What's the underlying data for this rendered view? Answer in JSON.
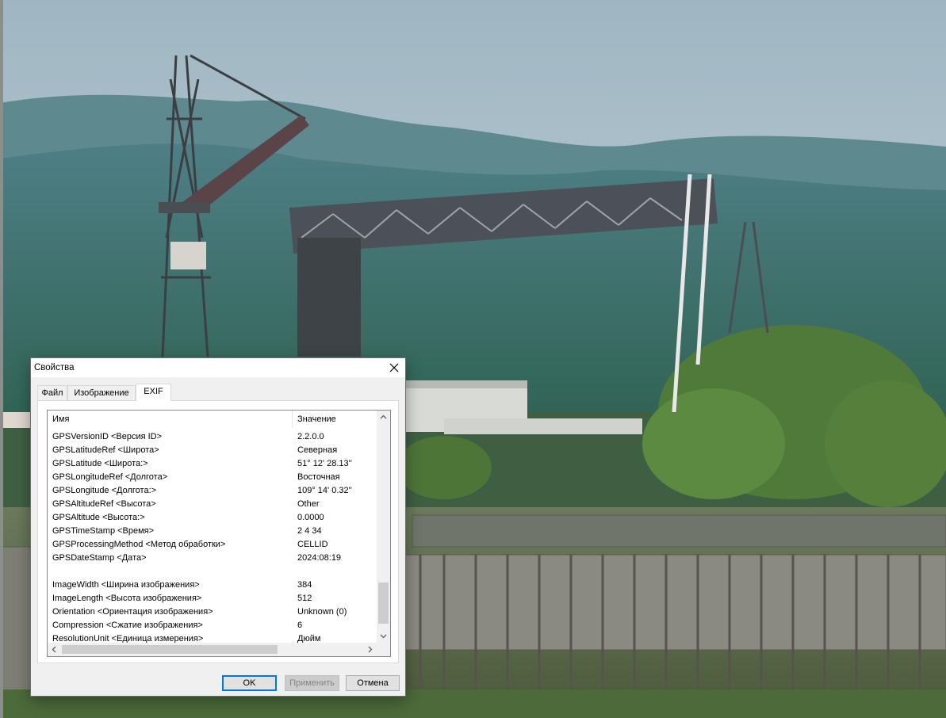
{
  "dialog": {
    "title": "Свойства",
    "close_icon": "close-icon",
    "tabs": [
      {
        "label": "Файл",
        "active": false
      },
      {
        "label": "Изображение",
        "active": false
      },
      {
        "label": "EXIF",
        "active": true
      }
    ],
    "list": {
      "columns": [
        "Имя",
        "Значение"
      ],
      "rows": [
        {
          "name": "GPSVersionID <Версия ID>",
          "value": "2.2.0.0"
        },
        {
          "name": "GPSLatitudeRef <Широта>",
          "value": "Северная"
        },
        {
          "name": "GPSLatitude <Широта:>",
          "value": "51° 12' 28.13''"
        },
        {
          "name": "GPSLongitudeRef <Долгота>",
          "value": "Восточная"
        },
        {
          "name": "GPSLongitude <Долгота:>",
          "value": "109° 14' 0.32''"
        },
        {
          "name": "GPSAltitudeRef <Высота>",
          "value": "Other"
        },
        {
          "name": "GPSAltitude <Высота:>",
          "value": "0.0000"
        },
        {
          "name": "GPSTimeStamp <Время>",
          "value": "2 4 34"
        },
        {
          "name": "GPSProcessingMethod <Метод обработки>",
          "value": "CELLID"
        },
        {
          "name": "GPSDateStamp <Дата>",
          "value": "2024:08:19"
        },
        {
          "name": "",
          "value": ""
        },
        {
          "name": "ImageWidth <Ширина изображения>",
          "value": "384"
        },
        {
          "name": "ImageLength <Высота изображения>",
          "value": "512"
        },
        {
          "name": "Orientation <Ориентация изображения>",
          "value": "Unknown (0)"
        },
        {
          "name": "Compression <Сжатие изображения>",
          "value": "6"
        },
        {
          "name": "ResolutionUnit <Единица измерения>",
          "value": "Дюйм"
        }
      ]
    },
    "buttons": {
      "ok": "OK",
      "apply": "Применить",
      "cancel": "Отмена"
    }
  },
  "colors": {
    "accent": "#0078d7",
    "sky": "#c8d6de",
    "forest": "#3b6a5a"
  }
}
